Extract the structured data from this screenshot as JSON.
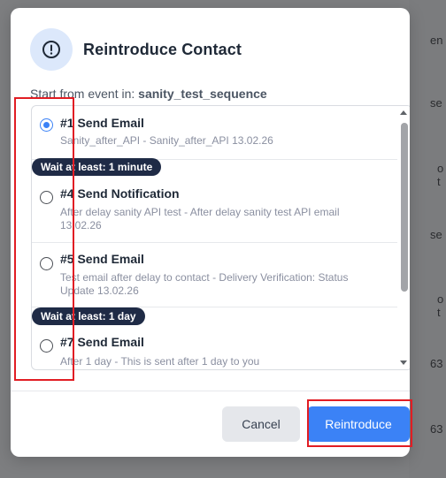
{
  "background": {
    "fragments": [
      "en",
      "se",
      "o t",
      "se",
      "o t",
      "63",
      "63"
    ]
  },
  "modal": {
    "title": "Reintroduce Contact",
    "header_icon": "alert-circle-icon",
    "subtitle_label": "Start from event in:",
    "subtitle_value": "sanity_test_sequence",
    "items": [
      {
        "title": "#1 Send Email",
        "description": "Sanity_after_API - Sanity_after_API 13.02.26",
        "selected": true
      },
      {
        "title": "#4 Send Notification",
        "description": "After delay sanity API test - After delay sanity test API email 13.02.26",
        "selected": false
      },
      {
        "title": "#5 Send Email",
        "description": "Test email after delay to contact - Delivery Verification: Status Update 13.02.26",
        "selected": false
      },
      {
        "title": "#7 Send Email",
        "description": "After 1 day - This is sent after 1 day to you",
        "selected": false
      }
    ],
    "waits": [
      {
        "label": "Wait at least: 1 minute"
      },
      {
        "label": "Wait at least: 1 day"
      }
    ],
    "buttons": {
      "cancel": "Cancel",
      "primary": "Reintroduce"
    }
  },
  "colors": {
    "accent": "#3b82f6",
    "annotation": "#e11d24",
    "wait_pill": "#1f2b46"
  }
}
